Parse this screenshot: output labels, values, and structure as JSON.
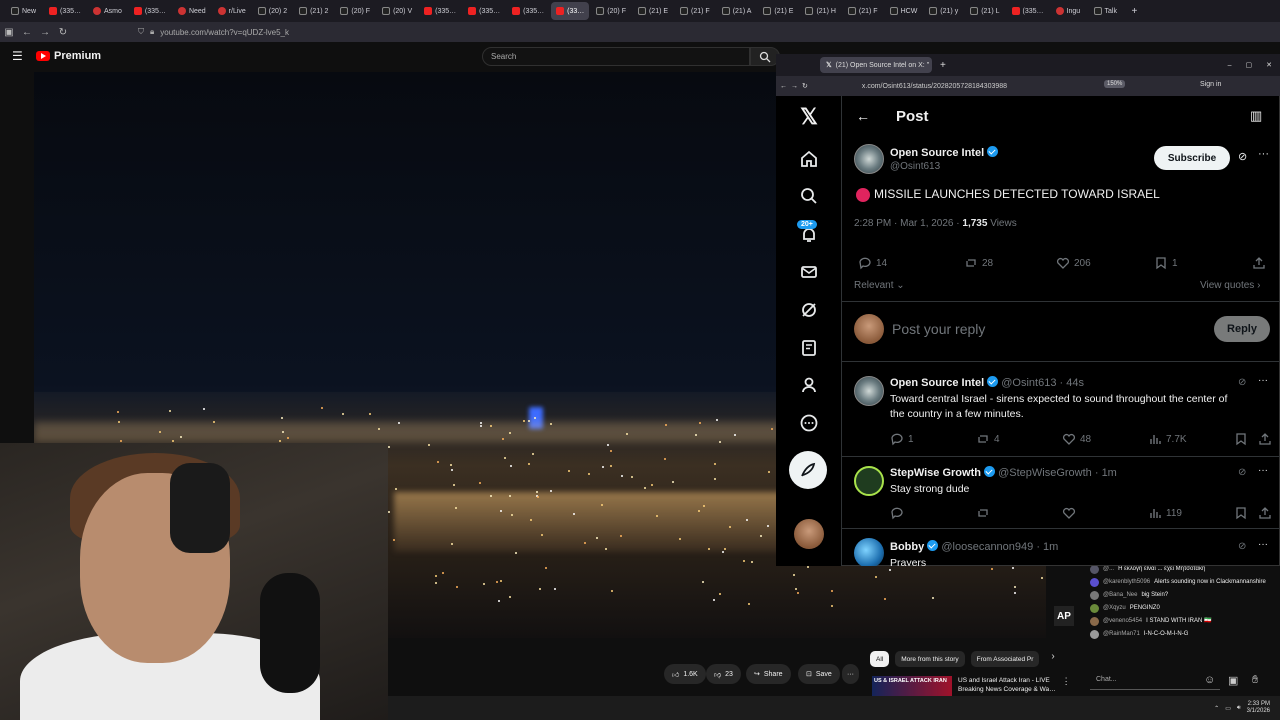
{
  "browser": {
    "tabs": [
      "New",
      "(335…",
      "Asmo",
      "(335…",
      "Need",
      "r/Live",
      "(20) 2",
      "(21) 2",
      "(20) F",
      "(20) V",
      "(335…",
      "(335…",
      "(335…",
      "(33…",
      "(20) F",
      "(21) E",
      "(21) F",
      "(21) A",
      "(21) E",
      "(21) H",
      "(21) F",
      "HCW",
      "(21) y",
      "(21) L",
      "(335…",
      "Ingu",
      "Talk"
    ],
    "url": "youtube.com/watch?v=qUDZ-lve5_k"
  },
  "youtube": {
    "logo_label": "Premium",
    "search_placeholder": "Search",
    "ap_badge": "AP",
    "actions": {
      "likes": "1.6K",
      "dislikes": "23",
      "share": "Share",
      "save": "Save",
      "more": "···"
    },
    "chips": [
      "All",
      "More from this story",
      "From Associated Pr"
    ],
    "recommendation": {
      "thumb_text": "US & ISRAEL ATTACK IRAN",
      "title": "US and Israel Attack Iran - LIVE",
      "subtitle": "Breaking News Coverage & Wa…"
    },
    "chat": {
      "messages": [
        {
          "user": "@...",
          "text": "Η εκλογή είναι ... εχει Μητσοτάκη"
        },
        {
          "user": "@karenblyth5096",
          "text": "Alerts sounding now in Clackmannanshire"
        },
        {
          "user": "@Bana_Nee",
          "text": "big Stein?"
        },
        {
          "user": "@Xqyzu",
          "text": "PENGINZ0"
        },
        {
          "user": "@veneno5454",
          "text": "I STAND WITH IRAN 🇮🇷"
        },
        {
          "user": "@RainMan71",
          "text": "I-N-C-O-M-I-N-G"
        }
      ],
      "placeholder": "Chat..."
    },
    "clock": {
      "time": "2:33 PM",
      "date": "3/1/2026"
    }
  },
  "xwindow": {
    "tab_title": "(21) Open Source Intel on X: \"",
    "url": "x.com/Osint613/status/2028205728184303988",
    "zoom": "150%",
    "sign_in": "Sign in",
    "notifications_badge": "20+",
    "header_title": "Post",
    "post": {
      "author": "Open Source Intel",
      "handle": "@Osint613",
      "subscribe": "Subscribe",
      "text": "MISSILE LAUNCHES DETECTED TOWARD ISRAEL",
      "time": "2:28 PM · Mar 1, 2026 ·",
      "views_count": "1,735",
      "views_label": "Views",
      "replies": "14",
      "reposts": "28",
      "likes": "206",
      "bookmarks": "1",
      "sort": "Relevant",
      "view_quotes": "View quotes"
    },
    "reply_box": {
      "placeholder": "Post your reply",
      "button": "Reply"
    },
    "replies": [
      {
        "author": "Open Source Intel",
        "handle": "@Osint613 · 44s",
        "text_line1": "Toward central Israel - sirens expected to sound throughout the center of",
        "text_line2": "the country in a few minutes.",
        "replies": "1",
        "reposts": "4",
        "likes": "48",
        "views": "7.7K"
      },
      {
        "author": "StepWise Growth",
        "handle": "@StepWiseGrowth · 1m",
        "text_line1": "Stay strong dude",
        "views": "119"
      },
      {
        "author": "Bobby",
        "handle": "@loosecannon949 · 1m",
        "text_line1": "Prayers"
      }
    ]
  }
}
